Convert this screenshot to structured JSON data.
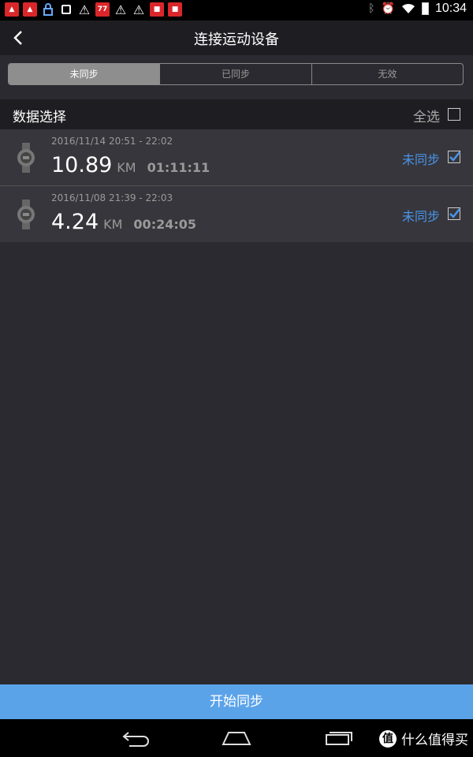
{
  "status_bar": {
    "time": "10:34",
    "notification_icons": [
      "app-red-icon",
      "app-red-icon",
      "lock-icon",
      "image-icon",
      "warning-icon",
      "app-77-icon",
      "warning-icon",
      "warning-icon",
      "app-news-icon",
      "app-news-icon"
    ],
    "app_77_text": "77"
  },
  "header": {
    "title": "连接运动设备"
  },
  "tabs": [
    {
      "label": "未同步",
      "active": true
    },
    {
      "label": "已同步",
      "active": false
    },
    {
      "label": "无效",
      "active": false
    }
  ],
  "section": {
    "title": "数据选择",
    "select_all_label": "全选",
    "select_all_checked": false
  },
  "records": [
    {
      "date": "2016/11/14 20:51 - 22:02",
      "distance": "10.89",
      "unit": "KM",
      "duration": "01:11:11",
      "status": "未同步",
      "checked": true
    },
    {
      "date": "2016/11/08 21:39 - 22:03",
      "distance": "4.24",
      "unit": "KM",
      "duration": "00:24:05",
      "status": "未同步",
      "checked": true
    }
  ],
  "footer": {
    "sync_button": "开始同步"
  },
  "watermark": {
    "logo": "值",
    "text": "什么值得买"
  },
  "colors": {
    "accent": "#5ba3e9",
    "status_blue": "#4a95e8",
    "background": "#2a2a30",
    "row": "#36363c"
  }
}
